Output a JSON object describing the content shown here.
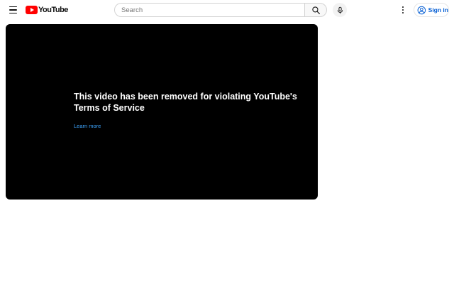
{
  "header": {
    "logo_text": "YouTube",
    "menu_icon": "hamburger-menu-icon",
    "search": {
      "placeholder": "Search",
      "value": "",
      "button_icon": "search-icon"
    },
    "voice_search_icon": "microphone-icon",
    "more_icon": "more-vertical-icon",
    "signin": {
      "label": "Sign in",
      "icon": "account-circle-icon"
    }
  },
  "player": {
    "message": "This video has been removed for violating YouTube's Terms of Service",
    "learn_more_label": "Learn more"
  },
  "colors": {
    "brand_red": "#ff0000",
    "link_blue": "#065fd4",
    "learn_more_blue": "#3ea6ff",
    "player_background": "#000000"
  }
}
